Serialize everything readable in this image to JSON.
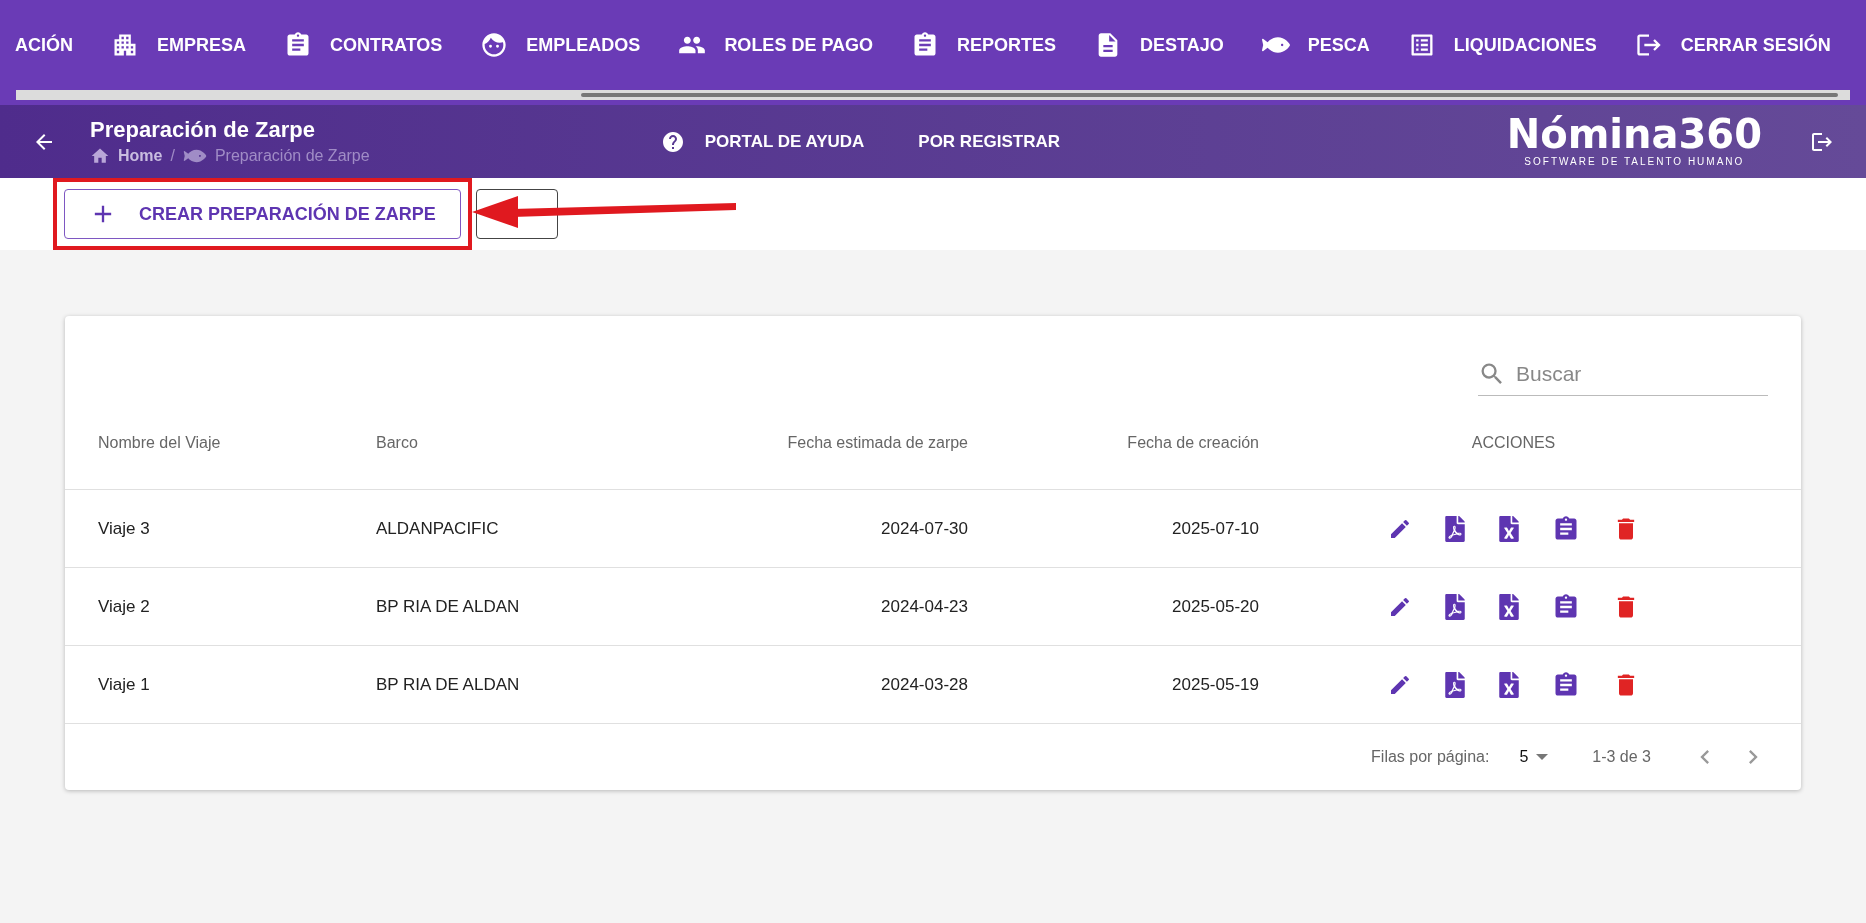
{
  "top_nav": {
    "items": [
      {
        "label": "ACIÓN"
      },
      {
        "label": "EMPRESA"
      },
      {
        "label": "CONTRATOS"
      },
      {
        "label": "EMPLEADOS"
      },
      {
        "label": "ROLES DE PAGO"
      },
      {
        "label": "REPORTES"
      },
      {
        "label": "DESTAJO"
      },
      {
        "label": "PESCA"
      },
      {
        "label": "LIQUIDACIONES"
      },
      {
        "label": "CERRAR SESIÓN"
      }
    ]
  },
  "header": {
    "title": "Preparación de Zarpe",
    "breadcrumb": [
      "Home",
      "/",
      "Preparación de Zarpe"
    ],
    "links": [
      "PORTAL DE AYUDA",
      "POR REGISTRAR"
    ],
    "logo": {
      "name": "Nómina360",
      "tagline": "SOFTWARE DE TALENTO HUMANO"
    }
  },
  "toolbar": {
    "create_button": "CREAR PREPARACIÓN DE ZARPE"
  },
  "table": {
    "search": {
      "placeholder": "Buscar"
    },
    "columns": [
      "Nombre del Viaje",
      "Barco",
      "Fecha estimada de zarpe",
      "Fecha de creación",
      "ACCIONES"
    ],
    "rows": [
      {
        "cells": [
          "Viaje 3",
          "ALDANPACIFIC",
          "2024-07-30",
          "2025-07-10"
        ]
      },
      {
        "cells": [
          "Viaje 2",
          "BP RIA DE ALDAN",
          "2024-04-23",
          "2025-05-20"
        ]
      },
      {
        "cells": [
          "Viaje 1",
          "BP RIA DE ALDAN",
          "2024-03-28",
          "2025-05-19"
        ]
      }
    ],
    "footer": {
      "rows_label": "Filas por página:",
      "rows_value": "5",
      "range": "1-3 de 3"
    }
  }
}
